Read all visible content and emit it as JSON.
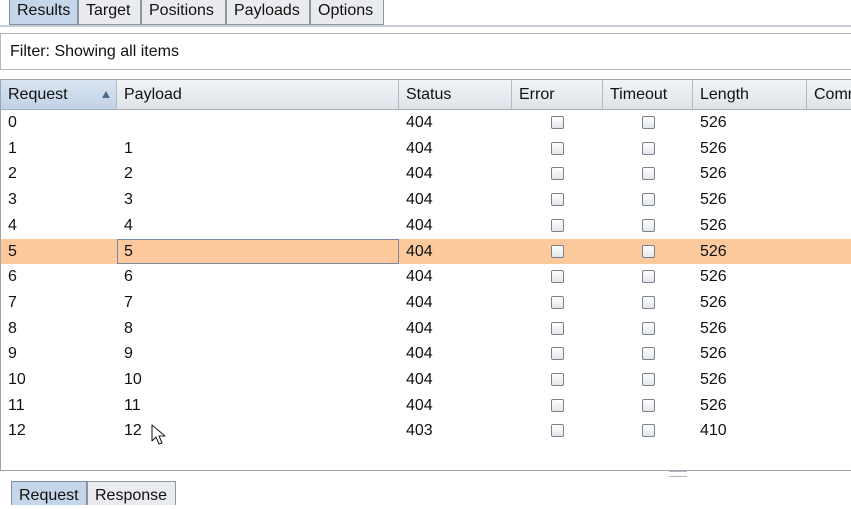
{
  "tabs": [
    "Results",
    "Target",
    "Positions",
    "Payloads",
    "Options"
  ],
  "active_tab": "Results",
  "filter": {
    "text": "Filter: Showing all items"
  },
  "table": {
    "columns": [
      "Request",
      "Payload",
      "Status",
      "Error",
      "Timeout",
      "Length",
      "Comm"
    ],
    "sorted_column": "Request",
    "sort_direction": "ascending",
    "selected_row": 5,
    "rows": [
      {
        "request": "0",
        "payload": "",
        "status": "404",
        "error": false,
        "timeout": false,
        "length": "526"
      },
      {
        "request": "1",
        "payload": "1",
        "status": "404",
        "error": false,
        "timeout": false,
        "length": "526"
      },
      {
        "request": "2",
        "payload": "2",
        "status": "404",
        "error": false,
        "timeout": false,
        "length": "526"
      },
      {
        "request": "3",
        "payload": "3",
        "status": "404",
        "error": false,
        "timeout": false,
        "length": "526"
      },
      {
        "request": "4",
        "payload": "4",
        "status": "404",
        "error": false,
        "timeout": false,
        "length": "526"
      },
      {
        "request": "5",
        "payload": "5",
        "status": "404",
        "error": false,
        "timeout": false,
        "length": "526"
      },
      {
        "request": "6",
        "payload": "6",
        "status": "404",
        "error": false,
        "timeout": false,
        "length": "526"
      },
      {
        "request": "7",
        "payload": "7",
        "status": "404",
        "error": false,
        "timeout": false,
        "length": "526"
      },
      {
        "request": "8",
        "payload": "8",
        "status": "404",
        "error": false,
        "timeout": false,
        "length": "526"
      },
      {
        "request": "9",
        "payload": "9",
        "status": "404",
        "error": false,
        "timeout": false,
        "length": "526"
      },
      {
        "request": "10",
        "payload": "10",
        "status": "404",
        "error": false,
        "timeout": false,
        "length": "526"
      },
      {
        "request": "11",
        "payload": "11",
        "status": "404",
        "error": false,
        "timeout": false,
        "length": "526"
      },
      {
        "request": "12",
        "payload": "12",
        "status": "403",
        "error": false,
        "timeout": false,
        "length": "410"
      }
    ]
  },
  "bottom_tabs": [
    "Request",
    "Response"
  ],
  "active_bottom_tab": "Request",
  "colors": {
    "selected_row": "#fbc99c",
    "active_tab": "#c6d6ea",
    "header": "#e4e8ee"
  },
  "icons": {
    "sort": "sort-ascending-icon",
    "pointer": "mouse-pointer-icon"
  }
}
